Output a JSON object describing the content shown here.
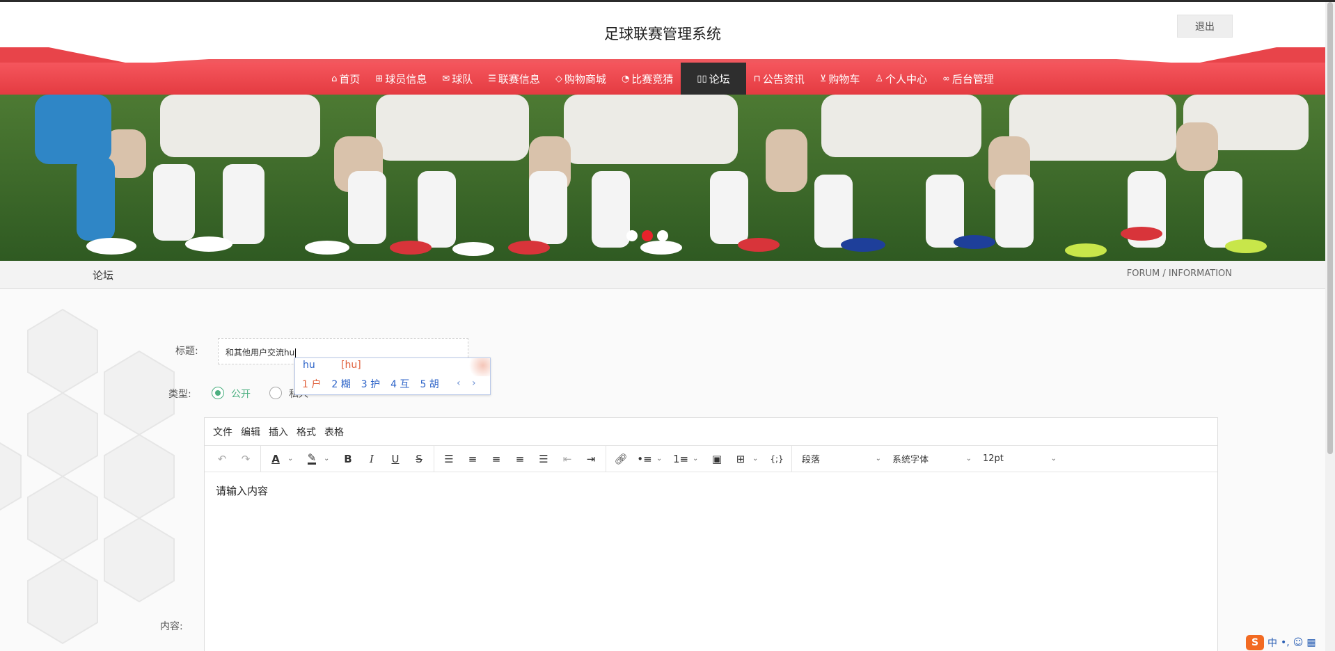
{
  "header": {
    "site_title": "足球联赛管理系统",
    "logout_label": "退出"
  },
  "nav": {
    "items": [
      {
        "label": "首页",
        "icon": "home-icon",
        "glyph": "⌂"
      },
      {
        "label": "球员信息",
        "icon": "gift-icon",
        "glyph": "⊞"
      },
      {
        "label": "球队",
        "icon": "mail-icon",
        "glyph": "✉"
      },
      {
        "label": "联赛信息",
        "icon": "sliders-icon",
        "glyph": "☰"
      },
      {
        "label": "购物商城",
        "icon": "tag-icon",
        "glyph": "◇"
      },
      {
        "label": "比赛竞猜",
        "icon": "palette-icon",
        "glyph": "◔"
      },
      {
        "label": "论坛",
        "icon": "book-icon",
        "glyph": "▯▯"
      },
      {
        "label": "公告资讯",
        "icon": "car-icon",
        "glyph": "⊓"
      },
      {
        "label": "购物车",
        "icon": "cart-icon",
        "glyph": "⊻"
      },
      {
        "label": "个人中心",
        "icon": "user-icon",
        "glyph": "♙"
      },
      {
        "label": "后台管理",
        "icon": "link-icon",
        "glyph": "∞"
      }
    ],
    "active_index": 6
  },
  "banner": {
    "carousel_count": 3,
    "active_dot": 1
  },
  "breadcrumb": {
    "left": "论坛",
    "right": "FORUM / INFORMATION"
  },
  "form": {
    "title_label": "标题:",
    "title_value": "和其他用户交流hu",
    "type_label": "类型:",
    "type_options": [
      "公开",
      "私人"
    ],
    "type_selected": "公开",
    "content_label": "内容:"
  },
  "ime": {
    "code": "hu",
    "pinyin": "[hu]",
    "candidates": [
      "1 户",
      "2 糊",
      "3 护",
      "4 互",
      "5 胡"
    ],
    "arrows": "‹ ›",
    "tray": [
      "中",
      "•,",
      "☺",
      "▦"
    ],
    "logo": "S"
  },
  "editor": {
    "menus": [
      "文件",
      "编辑",
      "插入",
      "格式",
      "表格"
    ],
    "block_format": "段落",
    "font_family": "系统字体",
    "font_size": "12pt",
    "placeholder": "请输入内容"
  }
}
